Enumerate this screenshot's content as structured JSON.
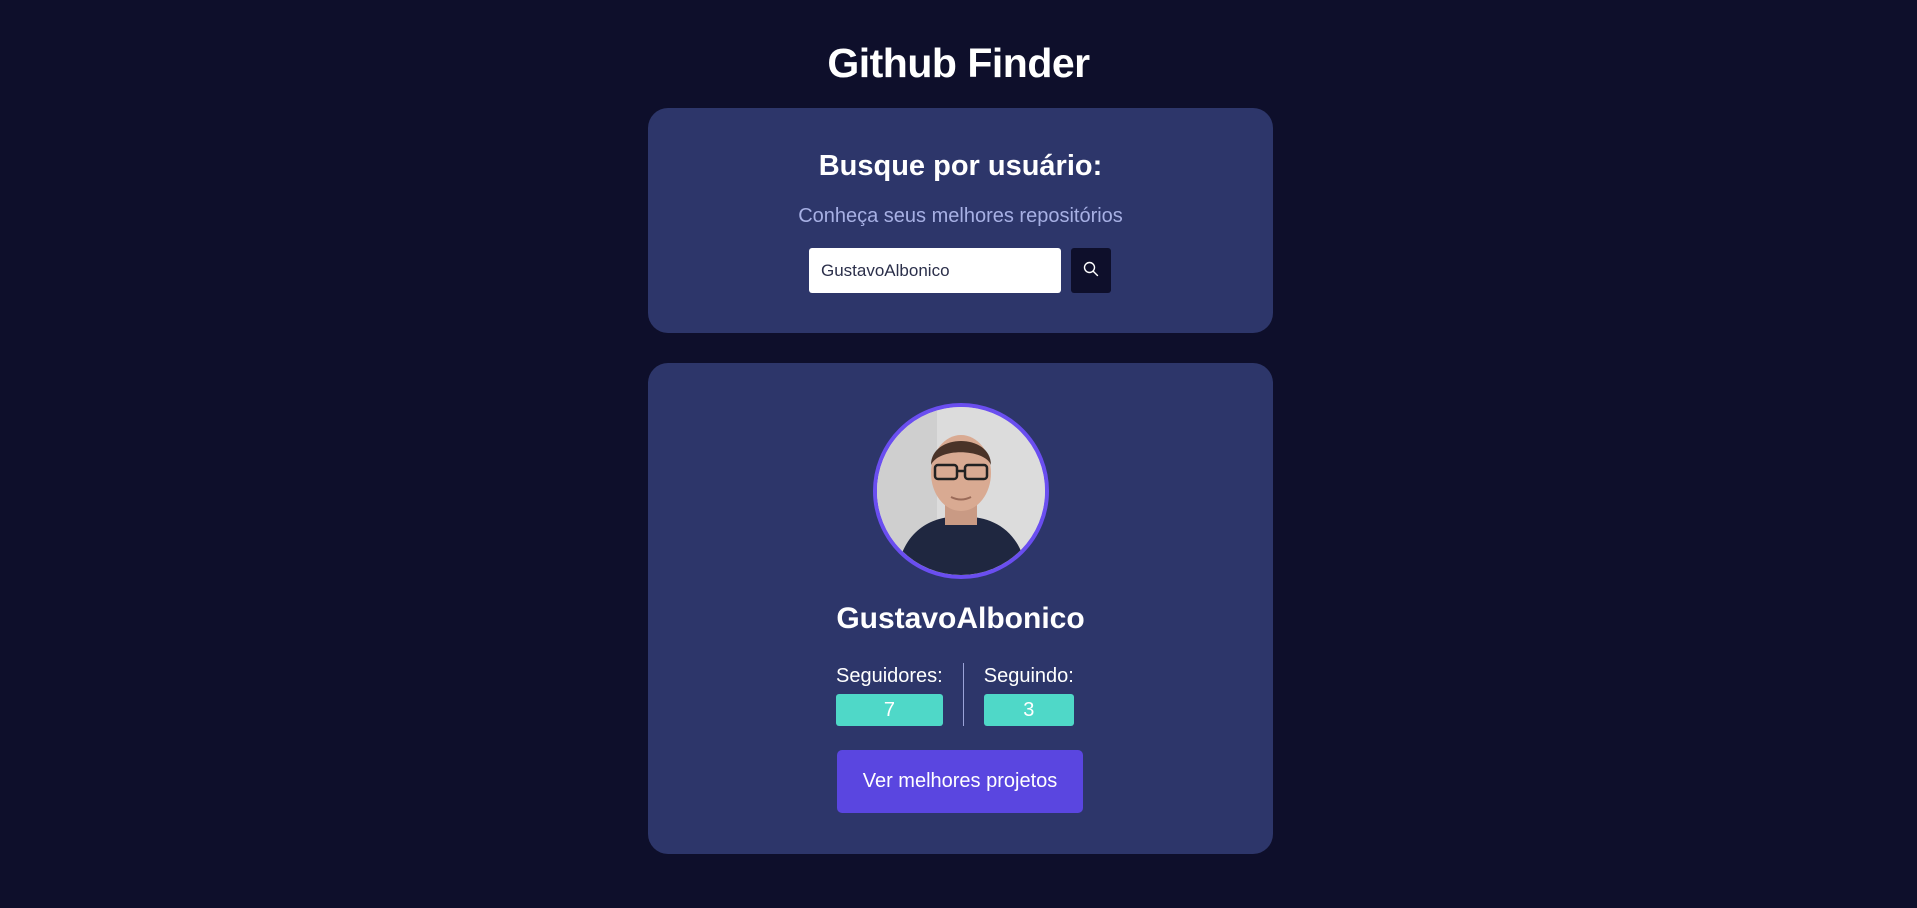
{
  "app": {
    "title": "Github Finder"
  },
  "search": {
    "heading": "Busque por usuário:",
    "subtitle": "Conheça seus melhores repositórios",
    "input_value": "GustavoAlbonico",
    "button_icon": "search-icon"
  },
  "profile": {
    "name": "GustavoAlbonico",
    "avatar_icon": "avatar",
    "followers_label": "Seguidores:",
    "followers_value": "7",
    "following_label": "Seguindo:",
    "following_value": "3",
    "projects_button_label": "Ver melhores projetos"
  },
  "colors": {
    "background": "#0e0f2b",
    "card": "#2d366a",
    "accent": "#5a46e0",
    "avatar_border": "#6a4ef0",
    "stat_badge": "#4fd8c8",
    "subtitle": "#a7b0e4"
  }
}
